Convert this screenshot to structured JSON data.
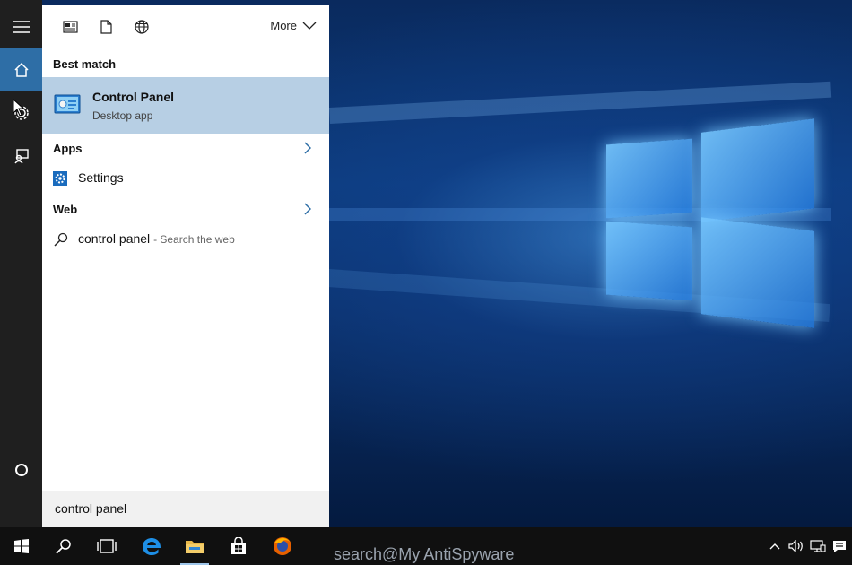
{
  "panel": {
    "filters": {
      "more_label": "More"
    },
    "best_match": {
      "header": "Best match",
      "title": "Control Panel",
      "subtitle": "Desktop app"
    },
    "apps": {
      "header": "Apps",
      "items": [
        {
          "label": "Settings"
        }
      ]
    },
    "web": {
      "header": "Web",
      "items": [
        {
          "query": "control panel",
          "hint": "- Search the web"
        }
      ]
    },
    "search": {
      "value": "control panel"
    }
  },
  "taskbar": {
    "watermark": "search@My AntiSpyware"
  },
  "colors": {
    "accent": "#2e6ea6",
    "selection": "#b7cfe4",
    "taskbar": "#101010",
    "rail": "#1f1f1f"
  }
}
